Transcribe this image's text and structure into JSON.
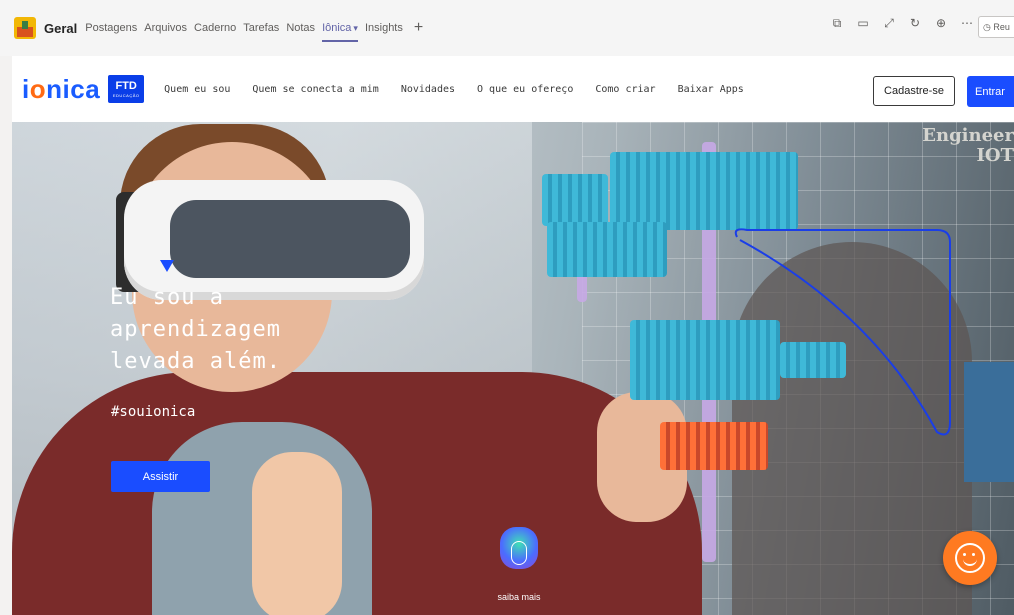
{
  "teams": {
    "channel": "Geral",
    "tabs": [
      {
        "label": "Postagens"
      },
      {
        "label": "Arquivos"
      },
      {
        "label": "Caderno"
      },
      {
        "label": "Tarefas"
      },
      {
        "label": "Notas"
      },
      {
        "label": "Iônica"
      },
      {
        "label": "Insights"
      }
    ],
    "add_tab": "+",
    "meet_label": "Reu"
  },
  "site": {
    "logo": {
      "text_before": "i",
      "text_o": "o",
      "text_after": "nica"
    },
    "ftd": {
      "label": "FTD",
      "sublabel": "EDUCAÇÃO"
    },
    "nav": [
      {
        "label": "Quem eu sou"
      },
      {
        "label": "Quem se conecta a mim"
      },
      {
        "label": "Novidades"
      },
      {
        "label": "O que eu ofereço"
      },
      {
        "label": "Como criar"
      },
      {
        "label": "Baixar Apps"
      }
    ],
    "signup_label": "Cadastre-se",
    "login_label": "Entrar"
  },
  "hero": {
    "title": "Eu sou a\naprendizagem\nlevada além.",
    "hashtag": "#souionica",
    "watch_label": "Assistir",
    "more_label": "saiba mais",
    "wall_text": "Engineer\nIOT"
  },
  "colors": {
    "accent_blue": "#1a4dff",
    "logo_orange": "#ff6a13",
    "teams_purple": "#6264a7",
    "chat_orange": "#ff7a21"
  }
}
